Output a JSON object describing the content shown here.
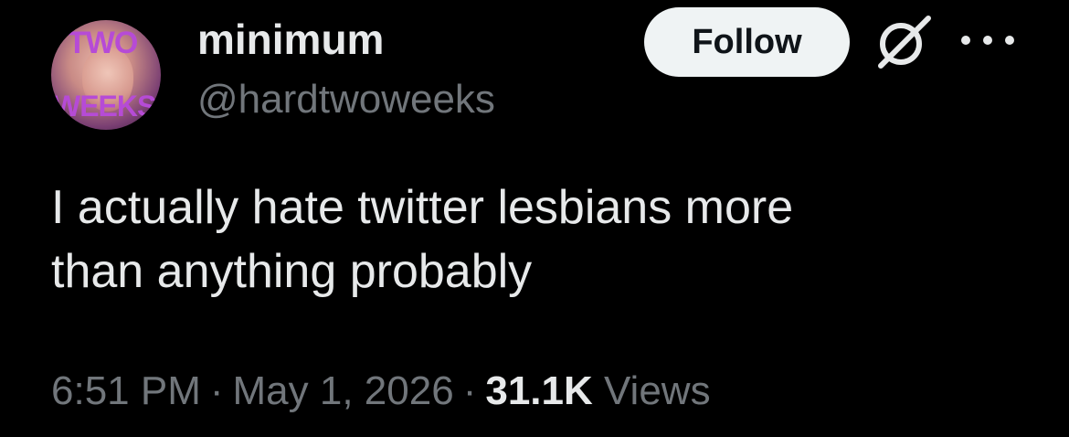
{
  "tweet": {
    "author": {
      "display_name": "minimum",
      "handle": "@hardtwoweeks",
      "avatar_text_top": "TWO",
      "avatar_text_bottom": "WEEKS"
    },
    "follow_label": "Follow",
    "text": "I actually hate twitter lesbians more\nthan anything probably",
    "time": "6:51 PM",
    "date": "May 1, 2026",
    "separator": "·",
    "views_count": "31.1K",
    "views_label": "Views"
  },
  "icons": {
    "grok": "grok-icon",
    "more": "more-icon"
  },
  "colors": {
    "background": "#000000",
    "primary_text": "#e7e9ea",
    "secondary_text": "#71767b",
    "button_bg": "#eff3f4",
    "button_text": "#0f1419",
    "avatar_accent": "#b64bd6"
  }
}
